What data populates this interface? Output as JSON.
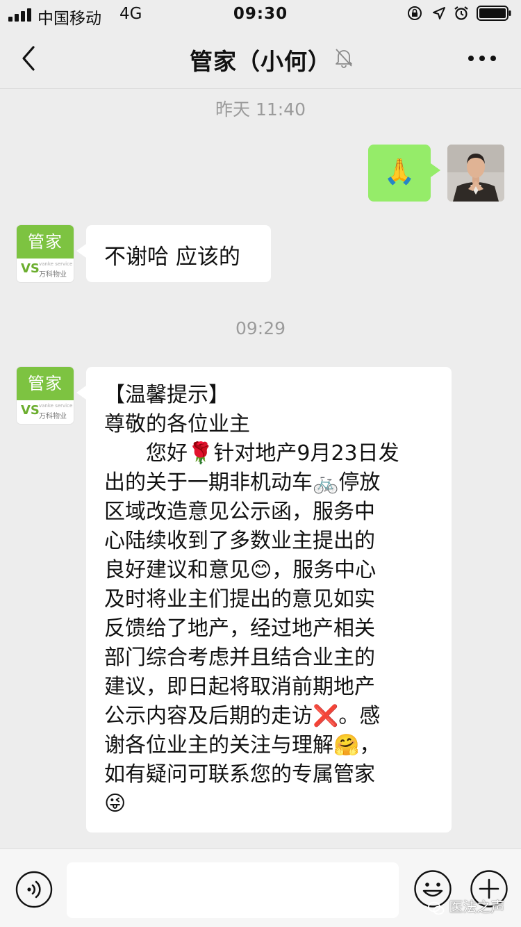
{
  "status_bar": {
    "carrier": "中国移动",
    "network": "4G",
    "time": "09:30"
  },
  "nav": {
    "title": "管家（小何）",
    "icons": [
      "back-chevron-icon",
      "mute-bell-icon",
      "more-dots-icon"
    ]
  },
  "chat": {
    "timestamp_1": "昨天 11:40",
    "my_message": "🙏",
    "reply_1": "不谢哈 应该的",
    "timestamp_2": "09:29",
    "manager_avatar": {
      "badge": "管家",
      "logo_mark": "VS",
      "logo_en": "vanke service",
      "logo_cn": "万科物业"
    },
    "notice_lines": [
      "【温馨提示】",
      "尊敬的各位业主",
      "　　您好🌹针对地产9月23日发",
      "出的关于一期非机动车🚲停放",
      "区域改造意见公示函，服务中",
      "心陆续收到了多数业主提出的",
      "良好建议和意见😊，服务中心",
      "及时将业主们提出的意见如实",
      "反馈给了地产，经过地产相关",
      "部门综合考虑并且结合业主的",
      "建议，即日起将取消前期地产",
      "公示内容及后期的走访❌。感",
      "谢各位业主的关注与理解🤗，",
      "如有疑问可联系您的专属管家",
      "😜"
    ]
  },
  "input_bar": {
    "value": "",
    "placeholder": "",
    "icons": [
      "voice-icon",
      "emoji-icon",
      "plus-icon"
    ]
  },
  "watermark": "医法之声",
  "colors": {
    "background": "#ededed",
    "my_bubble": "#95ec69",
    "other_bubble": "#ffffff",
    "brand_green": "#7dc341",
    "timestamp": "#9b9b9b"
  }
}
